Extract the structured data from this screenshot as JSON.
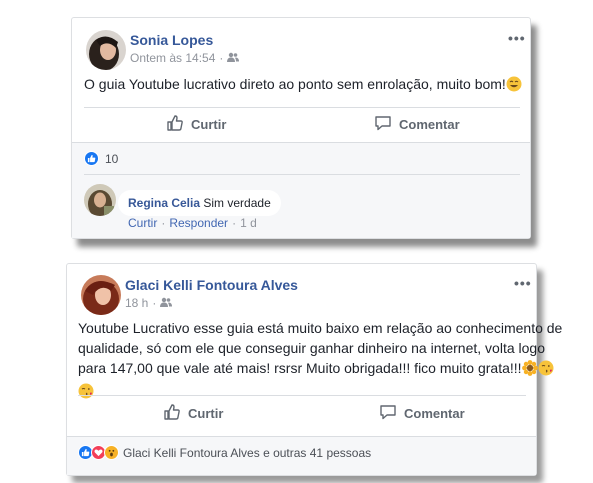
{
  "post1": {
    "author": "Sonia Lopes",
    "time": "Ontem às 14:54",
    "privacy_sep": "·",
    "more": "•••",
    "text": "O guia Youtube lucrativo direto ao ponto sem enrolação, muito bom!",
    "like_label": "Curtir",
    "comment_label": "Comentar",
    "reaction_count": "10",
    "comment": {
      "author": "Regina Celia",
      "text": "Sim verdade",
      "like": "Curtir",
      "reply": "Responder",
      "sep": "·",
      "time": "1 d"
    }
  },
  "post2": {
    "author": "Glaci Kelli Fontoura Alves",
    "time": "18 h",
    "privacy_sep": "·",
    "more": "•••",
    "text_line1": "Youtube Lucrativo esse guia está muito baixo em relação ao conhecimento de",
    "text_line2": "qualidade, só com ele que conseguir ganhar dinheiro na internet, volta logo",
    "text_line3": "para 147,00 que vale até mais! rsrsr Muito obrigada!!! fico muito grata!!!",
    "like_label": "Curtir",
    "comment_label": "Comentar",
    "reactions_text": "Glaci Kelli Fontoura Alves e outras 41 pessoas"
  },
  "colors": {
    "link_blue": "#365899",
    "like_blue": "#1877f2",
    "love_red": "#f33e58",
    "wow_yellow": "#f7b125",
    "muted_gray": "#90949c",
    "action_gray": "#606770"
  },
  "icons": [
    "privacy-friends-icon",
    "thumbs-up-icon",
    "comment-icon",
    "like-reaction-icon",
    "love-reaction-icon",
    "wow-reaction-icon",
    "smile-emoji",
    "sunflower-emoji",
    "kiss-emoji"
  ]
}
